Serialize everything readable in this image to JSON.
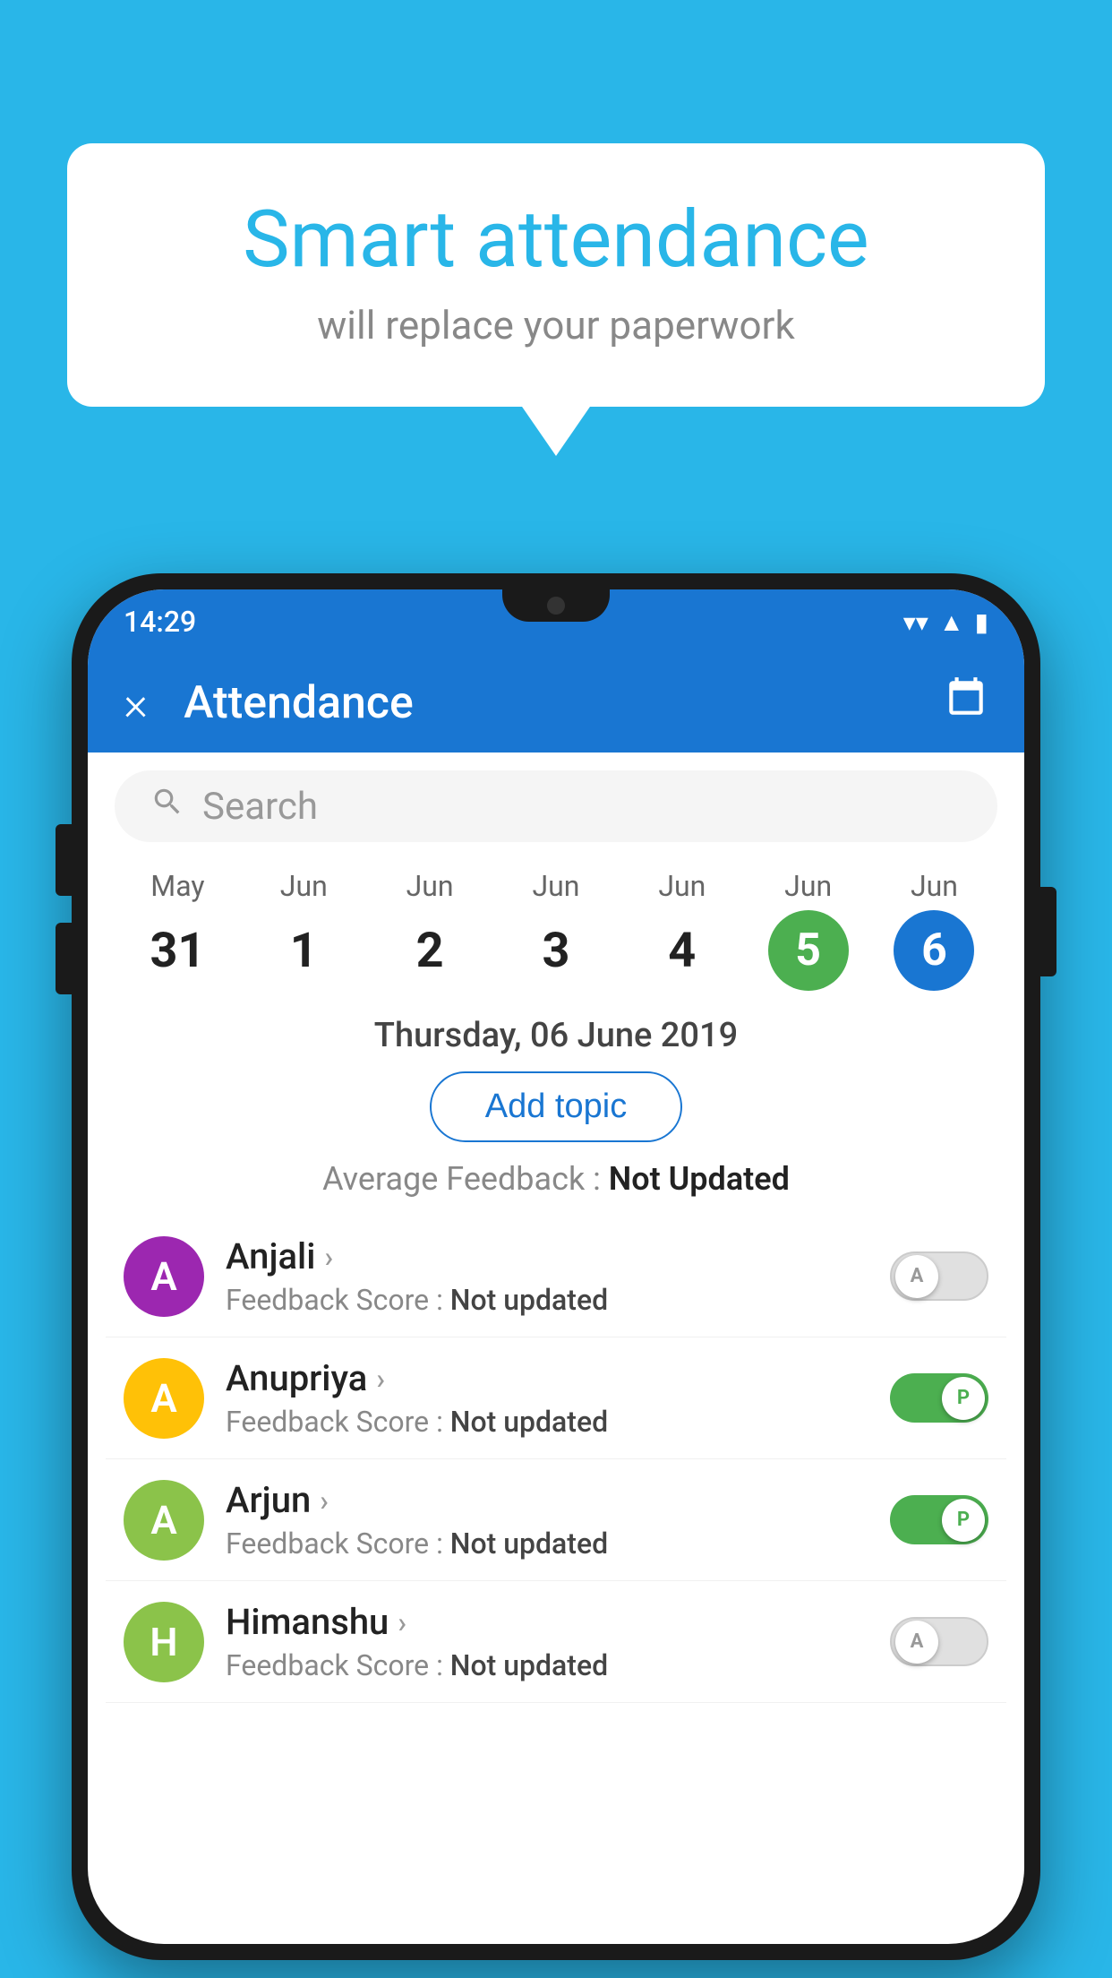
{
  "background": {
    "color": "#29B6E8"
  },
  "speech_bubble": {
    "title": "Smart attendance",
    "subtitle": "will replace your paperwork"
  },
  "phone": {
    "status_bar": {
      "time": "14:29",
      "wifi_icon": "wifi",
      "signal_icon": "signal",
      "battery_icon": "battery"
    },
    "app_bar": {
      "close_icon": "×",
      "title": "Attendance",
      "calendar_icon": "📅"
    },
    "search": {
      "placeholder": "Search"
    },
    "calendar": {
      "days": [
        {
          "month": "May",
          "date": "31",
          "style": "normal"
        },
        {
          "month": "Jun",
          "date": "1",
          "style": "normal"
        },
        {
          "month": "Jun",
          "date": "2",
          "style": "normal"
        },
        {
          "month": "Jun",
          "date": "3",
          "style": "normal"
        },
        {
          "month": "Jun",
          "date": "4",
          "style": "normal"
        },
        {
          "month": "Jun",
          "date": "5",
          "style": "green"
        },
        {
          "month": "Jun",
          "date": "6",
          "style": "blue"
        }
      ]
    },
    "selected_date": "Thursday, 06 June 2019",
    "add_topic_label": "Add topic",
    "avg_feedback_label": "Average Feedback :",
    "avg_feedback_value": "Not Updated",
    "students": [
      {
        "name": "Anjali",
        "avatar_letter": "A",
        "avatar_color": "#9C27B0",
        "feedback_label": "Feedback Score :",
        "feedback_value": "Not updated",
        "toggle": "off",
        "toggle_letter": "A"
      },
      {
        "name": "Anupriya",
        "avatar_letter": "A",
        "avatar_color": "#FFC107",
        "feedback_label": "Feedback Score :",
        "feedback_value": "Not updated",
        "toggle": "on",
        "toggle_letter": "P"
      },
      {
        "name": "Arjun",
        "avatar_letter": "A",
        "avatar_color": "#8BC34A",
        "feedback_label": "Feedback Score :",
        "feedback_value": "Not updated",
        "toggle": "on",
        "toggle_letter": "P"
      },
      {
        "name": "Himanshu",
        "avatar_letter": "H",
        "avatar_color": "#8BC34A",
        "feedback_label": "Feedback Score :",
        "feedback_value": "Not updated",
        "toggle": "off",
        "toggle_letter": "A"
      }
    ]
  }
}
